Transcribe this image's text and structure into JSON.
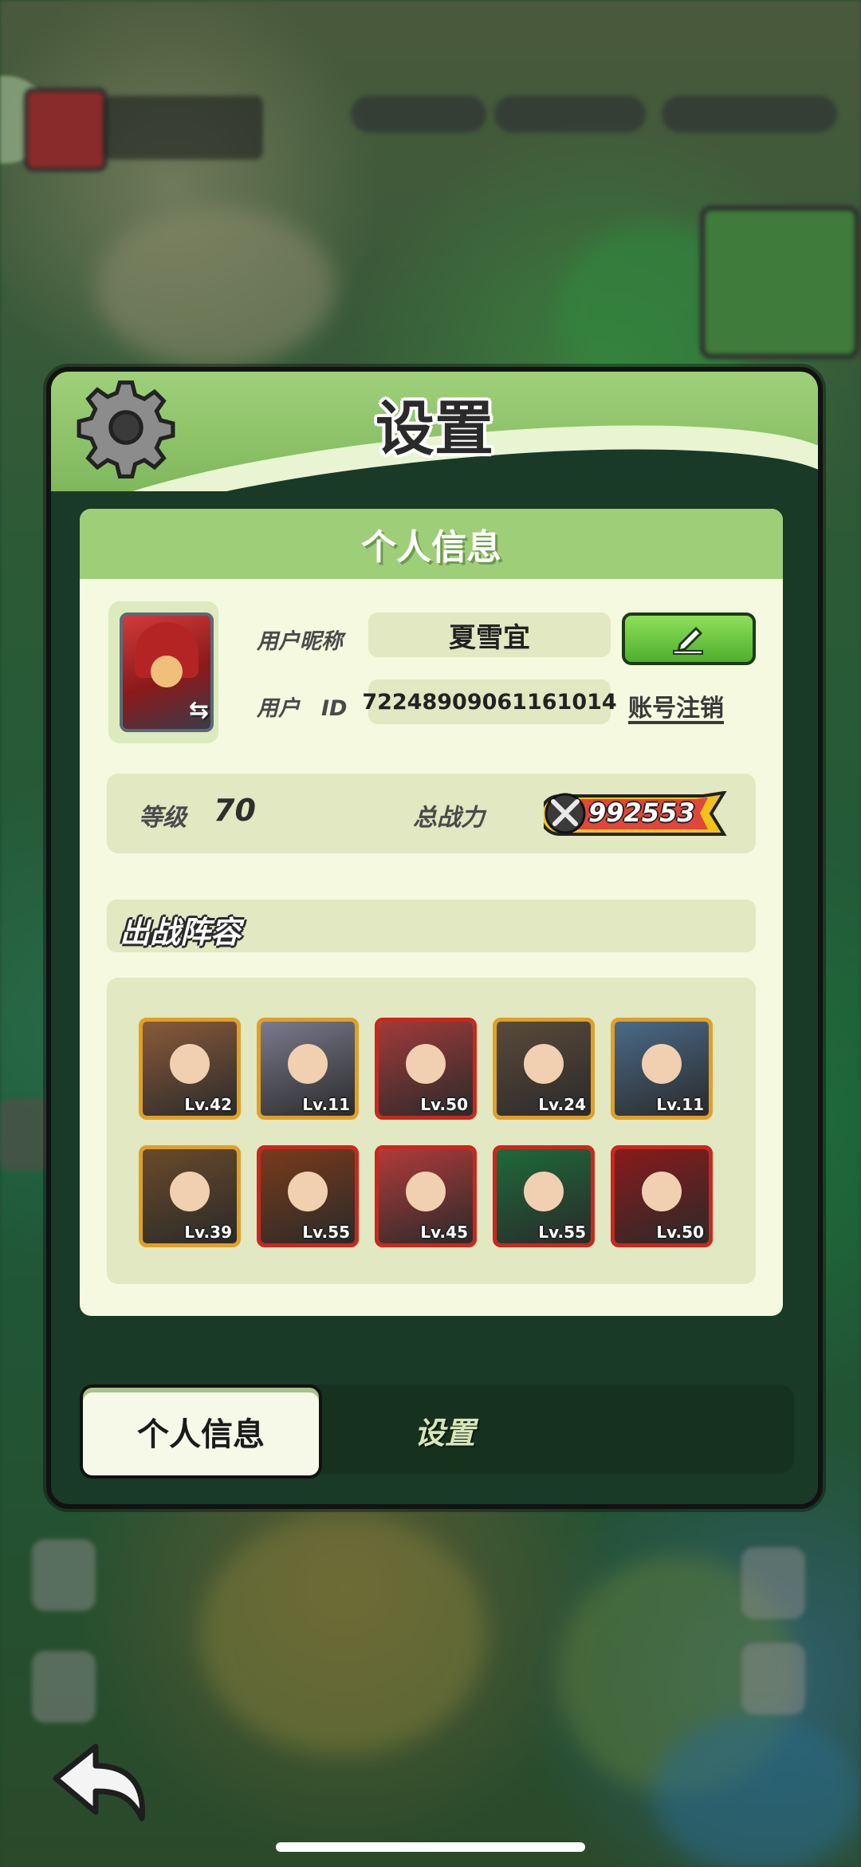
{
  "settings_dialog": {
    "title": "设置",
    "profile_card": {
      "title": "个人信息",
      "nickname_label": "用户昵称",
      "nickname_value": "夏雪宜",
      "id_label": "用户　ID",
      "id_value": "72248909061161014",
      "deregister_label": "账号注销",
      "level_label": "等级",
      "level_value": "70",
      "power_label": "总战力",
      "power_value": "992553",
      "lineup_title": "出战阵容",
      "heroes": [
        {
          "level": "Lv.42",
          "color": "#8a5a3a",
          "frame": "gold"
        },
        {
          "level": "Lv.11",
          "color": "#7a7a8e",
          "frame": "gold"
        },
        {
          "level": "Lv.50",
          "color": "#a23a3a",
          "frame": "red"
        },
        {
          "level": "Lv.24",
          "color": "#5a4a3a",
          "frame": "gold"
        },
        {
          "level": "Lv.11",
          "color": "#4a6a8a",
          "frame": "gold"
        },
        {
          "level": "Lv.39",
          "color": "#6a4a2a",
          "frame": "gold"
        },
        {
          "level": "Lv.55",
          "color": "#7a3a1a",
          "frame": "red"
        },
        {
          "level": "Lv.45",
          "color": "#b23a3a",
          "frame": "red"
        },
        {
          "level": "Lv.55",
          "color": "#1e6a3a",
          "frame": "red"
        },
        {
          "level": "Lv.50",
          "color": "#8a1a1a",
          "frame": "red"
        }
      ]
    },
    "tabs": [
      {
        "label": "个人信息",
        "active": true
      },
      {
        "label": "设置",
        "active": false
      }
    ]
  },
  "icons": {
    "settings": "gear-icon",
    "edit": "pencil-icon",
    "back": "back-arrow-icon",
    "swap": "swap-arrow-icon",
    "power": "crossed-swords-icon"
  },
  "colors": {
    "accent_green": "#8ee05a",
    "header_green": "#9fce78",
    "card_bg": "#f4f9df",
    "power_badge": "#f2c21c"
  }
}
